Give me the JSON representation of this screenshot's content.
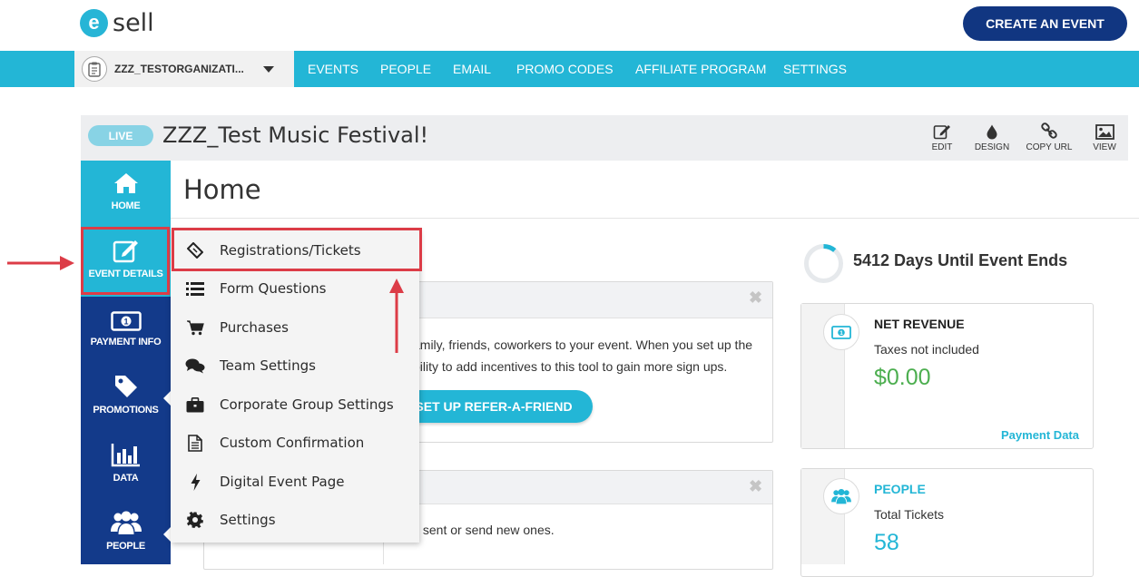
{
  "topbar": {
    "logo_letter": "e",
    "logo_word": "sell",
    "create_label": "CREATE AN EVENT"
  },
  "nav": {
    "org_name": "ZZZ_TESTORGANIZATI...",
    "items": [
      "EVENTS",
      "PEOPLE",
      "EMAIL",
      "PROMO CODES",
      "AFFILIATE PROGRAM",
      "SETTINGS"
    ]
  },
  "event": {
    "status": "LIVE",
    "title": "ZZZ_Test Music Festival!",
    "tools": [
      "EDIT",
      "DESIGN",
      "COPY URL",
      "VIEW"
    ]
  },
  "sidebar": {
    "items": [
      "HOME",
      "EVENT DETAILS",
      "PAYMENT INFO",
      "PROMOTIONS",
      "DATA",
      "PEOPLE"
    ]
  },
  "main": {
    "title": "Home",
    "refer_text_line1": "amily, friends, coworkers to your event. When you set up the",
    "refer_text_line2": "bility to add incentives to this tool to gain more sign ups.",
    "refer_button": "SET UP REFER-A-FRIEND",
    "message_text": "y sent or send new ones."
  },
  "dropdown": {
    "items": [
      "Registrations/Tickets",
      "Form Questions",
      "Purchases",
      "Team Settings",
      "Corporate Group Settings",
      "Custom Confirmation",
      "Digital Event Page",
      "Settings"
    ]
  },
  "stats": {
    "days_text": "5412 Days Until Event Ends",
    "revenue": {
      "title": "NET REVENUE",
      "subtitle": "Taxes not included",
      "value": "$0.00",
      "link": "Payment Data"
    },
    "people": {
      "title": "PEOPLE",
      "subtitle": "Total Tickets",
      "value": "58"
    }
  },
  "colors": {
    "accent": "#23b6d6",
    "navy": "#133a8a",
    "green": "#4cae4f",
    "annotation": "#dc3c47"
  }
}
